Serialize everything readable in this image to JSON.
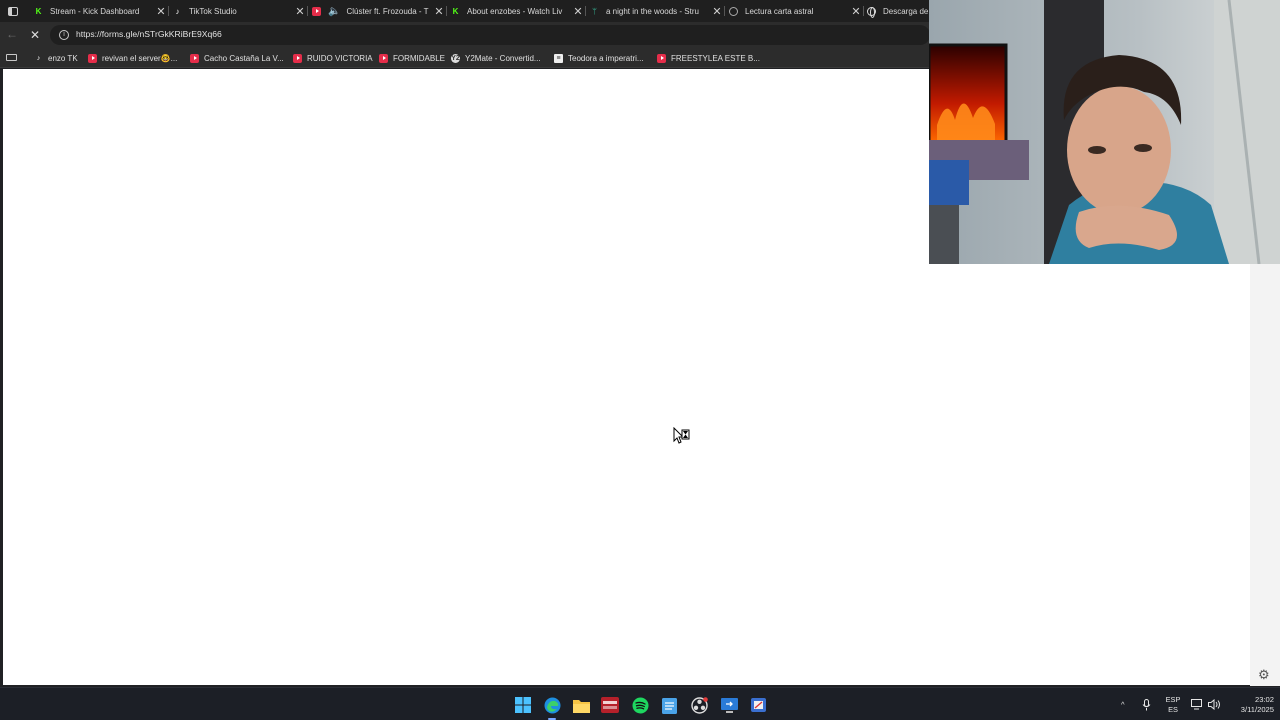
{
  "browser": {
    "tabs": [
      {
        "title": "Stream - Kick Dashboard",
        "icon": "kick-icon"
      },
      {
        "title": "TikTok Studio",
        "icon": "tiktok-icon"
      },
      {
        "title": "Clúster ft. Frozouda - T",
        "icon": "youtube-icon",
        "audio": true
      },
      {
        "title": "About enzobes - Watch Liv",
        "icon": "kick-icon"
      },
      {
        "title": "a night in the woods - Stru",
        "icon": "strut-icon"
      },
      {
        "title": "Lectura carta astral",
        "icon": "circle-icon"
      },
      {
        "title": "Descarga de",
        "icon": "globe-icon"
      }
    ],
    "url": "https://forms.gle/nSTrGkKRiBrE9Xq66",
    "bookmarks": [
      {
        "label": "enzo TK",
        "icon": "tiktok-icon"
      },
      {
        "label": "revivan el server🤓...",
        "icon": "youtube-icon"
      },
      {
        "label": "Cacho Castaña La V...",
        "icon": "youtube-icon"
      },
      {
        "label": "RUIDO VICTORIA",
        "icon": "youtube-icon"
      },
      {
        "label": "FORMIDABLE",
        "icon": "youtube-icon"
      },
      {
        "label": "Y2Mate - Convertid...",
        "icon": "y2mate-icon"
      },
      {
        "label": "Teodora a imperatri...",
        "icon": "document-icon"
      },
      {
        "label": "FREESTYLEA ESTE B...",
        "icon": "youtube-icon"
      }
    ]
  },
  "taskbar": {
    "apps": [
      "windows-start-icon",
      "edge-icon",
      "file-explorer-icon",
      "stream-app-icon",
      "spotify-icon",
      "notepad-icon",
      "obs-icon",
      "remote-desktop-icon",
      "snipping-tool-icon"
    ],
    "tray": {
      "language_top": "ESP",
      "language_bottom": "ES",
      "time": "23:02",
      "date": "3/11/2025"
    }
  },
  "colors": {
    "kick_green": "#53fc18",
    "youtube_red": "#e52d4a",
    "taskbar_bg": "#1c1f26",
    "page_bg": "#ffffff"
  }
}
